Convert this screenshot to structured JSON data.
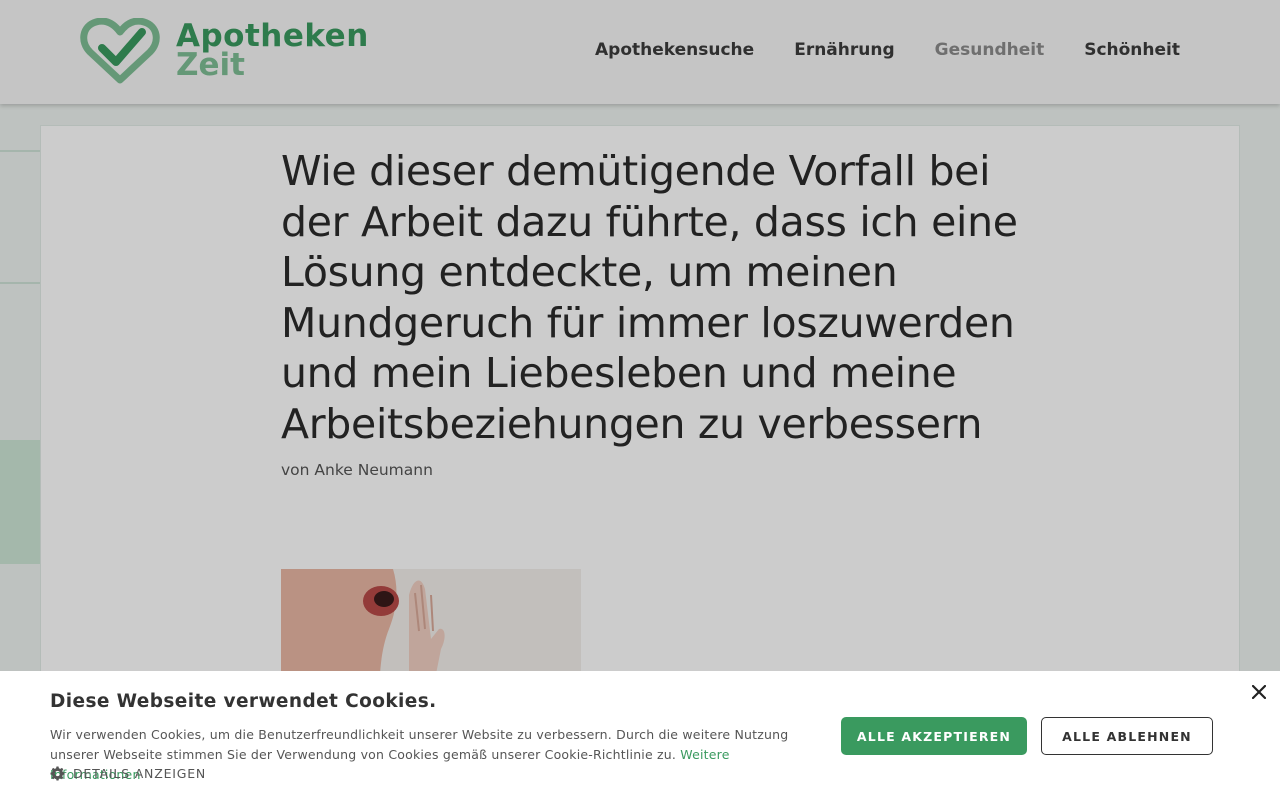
{
  "header": {
    "logo": {
      "line1": "Apotheken",
      "line2": "Zeit"
    },
    "nav": [
      {
        "label": "Apothekensuche"
      },
      {
        "label": "Ernährung"
      },
      {
        "label": "Gesundheit"
      },
      {
        "label": "Schönheit"
      }
    ]
  },
  "article": {
    "title": "Wie dieser demütigende Vorfall bei der Arbeit dazu führte, dass ich eine Lösung entdeckte, um meinen Mundgeruch für immer loszuwerden und mein Liebesleben und meine Arbeitsbeziehungen zu verbessern",
    "byline": "von Anke Neumann"
  },
  "cookie": {
    "title": "Diese Webseite verwendet Cookies.",
    "text": "Wir verwenden Cookies, um die Benutzerfreundlichkeit unserer Website zu verbessern. Durch die weitere Nutzung unserer Webseite stimmen Sie der Verwendung von Cookies gemäß unserer Cookie-Richtlinie zu.",
    "more_link": "Weitere Informationen",
    "details_label": "DETAILS ANZEIGEN",
    "accept_label": "ALLE AKZEPTIEREN",
    "reject_label": "ALLE ABLEHNEN",
    "close_symbol": "×"
  },
  "colors": {
    "brand": "#3a9a5f",
    "brand_light": "#7fbf95",
    "nav_text": "#3d3d3d",
    "nav_muted": "#8b8b8b"
  },
  "icons": [
    "logo-heart-check-icon",
    "gear-icon",
    "close-icon"
  ]
}
